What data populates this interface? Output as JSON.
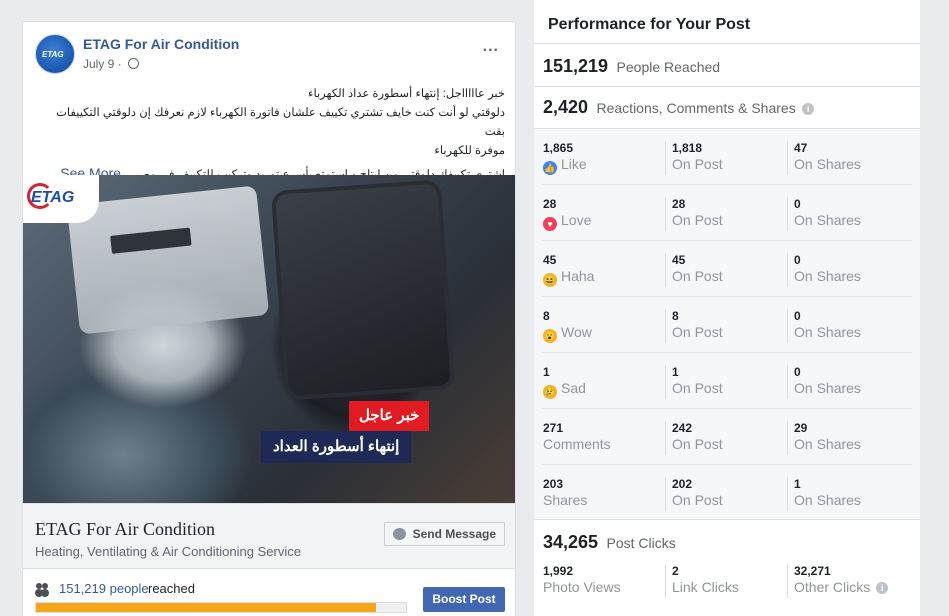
{
  "post": {
    "page_name": "ETAG For Air Condition",
    "date": "July 9 ·",
    "avatar_text": "ETAG",
    "more_icon": "...",
    "text_lines": [
      "خبر عاااااجل: إنتهاء أسطورة عداد الكهرباء",
      "دلوقتي لو أنت كنت خايف تشتري تكييف علشان فاتورة الكهرباء لازم نعرفك إن دلوقتي التكييفات بقت",
      "موفرة للكهرباء"
    ],
    "text_last": "إشتري تكييفك دلوقتي من إيتاج و إستمتع بأسرع توريد وتركيب للتكييف في مصر...",
    "see_more": "See More",
    "image": {
      "logo_text": "ETAG",
      "badge_red": "خبر عاجل",
      "badge_dark": "إنتهاء أسطورة العداد"
    },
    "cta": {
      "title": "ETAG For Air Condition",
      "subtitle": "Heating, Ventilating & Air Conditioning Service",
      "send_message_label": "Send Message"
    },
    "reach": {
      "count": "151,219 people",
      "label": "reached",
      "progress": 0.92
    },
    "boost_label": "Boost Post"
  },
  "panel": {
    "title": "Performance for Your Post",
    "people_reached": {
      "value": "151,219",
      "label": "People Reached"
    },
    "engagement": {
      "value": "2,420",
      "label": "Reactions, Comments & Shares"
    },
    "rows": [
      {
        "icon": "like-icon",
        "icon_color": "#4080ff",
        "total": "1,865",
        "label": "Like",
        "on_post": "1,818",
        "on_post_label": "On Post",
        "on_shares": "47",
        "on_shares_label": "On Shares"
      },
      {
        "icon": "love-icon",
        "icon_color": "#f33e58",
        "total": "28",
        "label": "Love",
        "on_post": "28",
        "on_post_label": "On Post",
        "on_shares": "0",
        "on_shares_label": "On Shares"
      },
      {
        "icon": "haha-icon",
        "icon_color": "#f7b125",
        "total": "45",
        "label": "Haha",
        "on_post": "45",
        "on_post_label": "On Post",
        "on_shares": "0",
        "on_shares_label": "On Shares"
      },
      {
        "icon": "wow-icon",
        "icon_color": "#f7b125",
        "total": "8",
        "label": "Wow",
        "on_post": "8",
        "on_post_label": "On Post",
        "on_shares": "0",
        "on_shares_label": "On Shares"
      },
      {
        "icon": "sad-icon",
        "icon_color": "#f7b125",
        "total": "1",
        "label": "Sad",
        "on_post": "1",
        "on_post_label": "On Post",
        "on_shares": "0",
        "on_shares_label": "On Shares"
      },
      {
        "icon": "",
        "icon_color": "",
        "total": "271",
        "label": "Comments",
        "on_post": "242",
        "on_post_label": "On Post",
        "on_shares": "29",
        "on_shares_label": "On Shares"
      },
      {
        "icon": "",
        "icon_color": "",
        "total": "203",
        "label": "Shares",
        "on_post": "202",
        "on_post_label": "On Post",
        "on_shares": "1",
        "on_shares_label": "On Shares"
      }
    ],
    "post_clicks": {
      "value": "34,265",
      "label": "Post Clicks"
    },
    "clicks": [
      {
        "value": "1,992",
        "label": "Photo Views"
      },
      {
        "value": "2",
        "label": "Link Clicks"
      },
      {
        "value": "32,271",
        "label": "Other Clicks"
      }
    ],
    "info_glyph": "i"
  }
}
